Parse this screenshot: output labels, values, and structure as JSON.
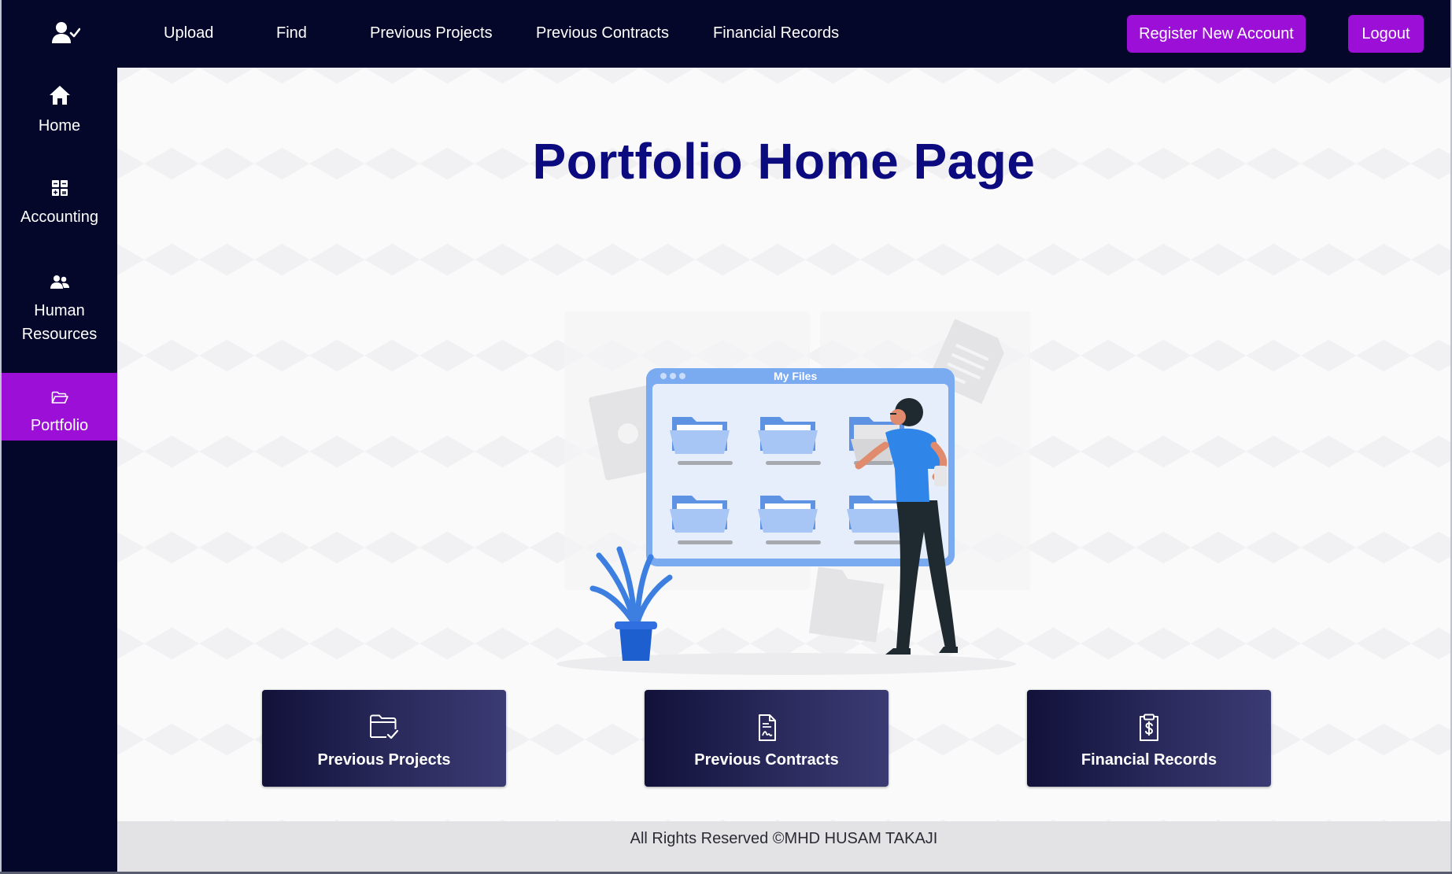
{
  "topbar": {
    "logo_icon": "user-check-icon",
    "nav": [
      {
        "label": "Upload"
      },
      {
        "label": "Find"
      },
      {
        "label": "Previous Projects"
      },
      {
        "label": "Previous Contracts"
      },
      {
        "label": "Financial Records"
      }
    ],
    "register_label": "Register New Account",
    "logout_label": "Logout"
  },
  "sidebar": {
    "items": [
      {
        "label": "Home",
        "icon": "home-icon"
      },
      {
        "label": "Accounting",
        "icon": "calculator-icon"
      },
      {
        "label_line1": "Human",
        "label_line2": "Resources",
        "icon": "users-icon"
      },
      {
        "label": "Portfolio",
        "icon": "folder-open-icon",
        "active": true
      }
    ]
  },
  "main": {
    "title": "Portfolio Home Page",
    "hero": {
      "window_title": "My Files"
    },
    "cards": [
      {
        "label": "Previous Projects",
        "icon": "folder-check-icon"
      },
      {
        "label": "Previous Contracts",
        "icon": "contract-icon"
      },
      {
        "label": "Financial Records",
        "icon": "clipboard-dollar-icon"
      }
    ]
  },
  "footer": {
    "text": "All Rights Reserved ©MHD HUSAM TAKAJI"
  },
  "colors": {
    "nav_bg": "#04072a",
    "accent": "#9b0fd6",
    "title": "#0b0b7f",
    "card_bg": "#1a1a48",
    "footer_bg": "#e3e3e5"
  }
}
